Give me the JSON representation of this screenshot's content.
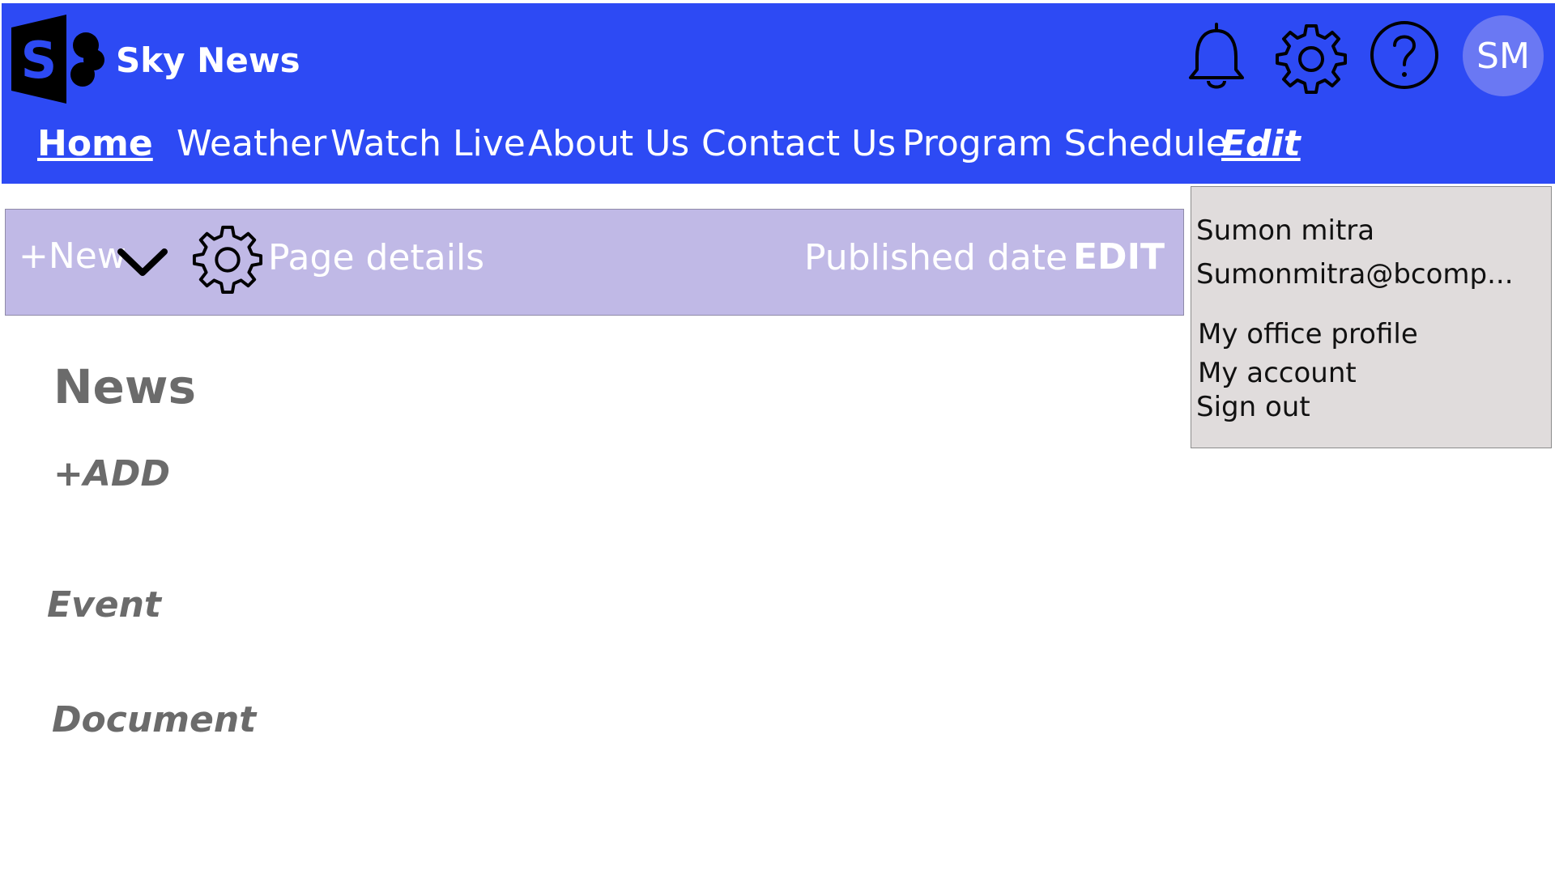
{
  "header": {
    "site_title": "Sky News",
    "logo_icon": "sharepoint-logo-icon",
    "brand_color": "#2d4af4",
    "icons": [
      "bell-icon",
      "gear-icon",
      "help-icon"
    ],
    "avatar_initials": "SM",
    "avatar_color": "#6a78f3"
  },
  "nav": {
    "items": [
      {
        "label": "Home",
        "active": true
      },
      {
        "label": "Weather"
      },
      {
        "label": "Watch Live"
      },
      {
        "label": "About Us"
      },
      {
        "label": "Contact Us"
      },
      {
        "label": "Program Schedule"
      },
      {
        "label": "Edit"
      }
    ]
  },
  "command_bar": {
    "new_label": "+New",
    "page_details_label": "Page details",
    "published_date_label": "Published date",
    "edit_label": "EDIT",
    "background_color": "#c0b9e6"
  },
  "content": {
    "title": "News",
    "add_label": "+ADD",
    "event_label": "Event",
    "document_label": "Document"
  },
  "profile_menu": {
    "name": "Sumon mitra",
    "email": "Sumonmitra@bcomp...",
    "items": [
      "My office profile",
      "My account",
      "Sign out"
    ]
  }
}
